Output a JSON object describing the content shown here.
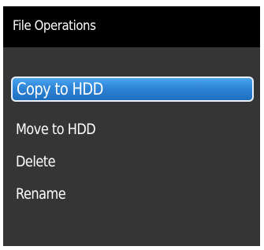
{
  "dialog": {
    "title": "File Operations",
    "selected_index": 0,
    "items": [
      {
        "label": "Copy to HDD"
      },
      {
        "label": "Move to HDD"
      },
      {
        "label": "Delete"
      },
      {
        "label": "Rename"
      }
    ]
  },
  "colors": {
    "header_bg": "#000000",
    "panel_bg": "#353535",
    "highlight": "#2f84d6",
    "text": "#ffffff"
  }
}
